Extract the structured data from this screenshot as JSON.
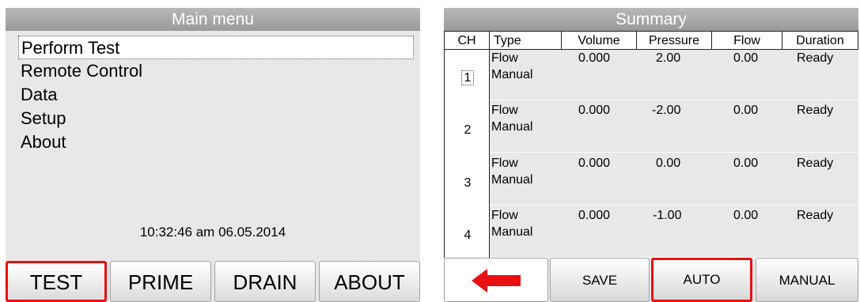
{
  "main_menu": {
    "title": "Main menu",
    "items": [
      {
        "label": "Perform Test",
        "selected": true
      },
      {
        "label": "Remote Control",
        "selected": false
      },
      {
        "label": "Data",
        "selected": false
      },
      {
        "label": "Setup",
        "selected": false
      },
      {
        "label": "About",
        "selected": false
      }
    ],
    "datetime": "10:32:46 am 06.05.2014",
    "softkeys": [
      {
        "label": "TEST",
        "active": true
      },
      {
        "label": "PRIME",
        "active": false
      },
      {
        "label": "DRAIN",
        "active": false
      },
      {
        "label": "ABOUT",
        "active": false
      }
    ]
  },
  "summary": {
    "title": "Summary",
    "columns": [
      "CH",
      "Type",
      "Volume",
      "Pressure",
      "Flow",
      "Duration"
    ],
    "rows": [
      {
        "ch": "1",
        "type_line1": "Flow",
        "type_line2": "Manual",
        "volume": "0.000",
        "pressure": "2.00",
        "flow": "0.00",
        "duration": "Ready",
        "selected": true
      },
      {
        "ch": "2",
        "type_line1": "Flow",
        "type_line2": "Manual",
        "volume": "0.000",
        "pressure": "-2.00",
        "flow": "0.00",
        "duration": "Ready",
        "selected": false
      },
      {
        "ch": "3",
        "type_line1": "Flow",
        "type_line2": "Manual",
        "volume": "0.000",
        "pressure": "0.00",
        "flow": "0.00",
        "duration": "Ready",
        "selected": false
      },
      {
        "ch": "4",
        "type_line1": "Flow",
        "type_line2": "Manual",
        "volume": "0.000",
        "pressure": "-1.00",
        "flow": "0.00",
        "duration": "Ready",
        "selected": false
      }
    ],
    "softkeys": [
      {
        "label": "",
        "icon": "back-arrow-icon",
        "active": false
      },
      {
        "label": "SAVE",
        "active": false
      },
      {
        "label": "AUTO",
        "active": true
      },
      {
        "label": "MANUAL",
        "active": false
      }
    ],
    "colors": {
      "accent_red": "#e81010",
      "titlebar_gray": "#a8a8a8",
      "panel_gray": "#e8e8e8"
    }
  }
}
